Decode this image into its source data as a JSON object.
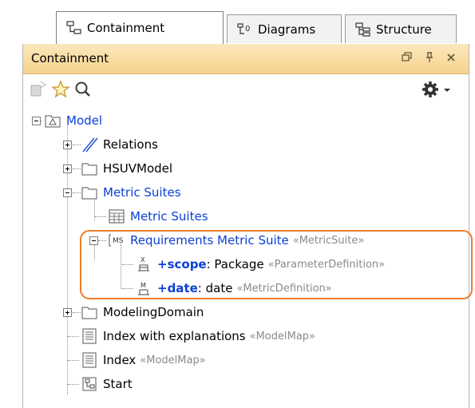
{
  "tabs": [
    {
      "label": "Containment",
      "active": true,
      "icon": "containment-icon"
    },
    {
      "label": "Diagrams",
      "active": false,
      "icon": "diagrams-icon"
    },
    {
      "label": "Structure",
      "active": false,
      "icon": "structure-icon"
    }
  ],
  "panel": {
    "title": "Containment",
    "header_icons": [
      "restore-icon",
      "pin-icon",
      "close-icon"
    ]
  },
  "toolbar": {
    "icons": [
      "new-element-icon",
      "favorite-star-icon",
      "search-icon",
      "settings-gear-icon",
      "dropdown-arrow-icon"
    ]
  },
  "tree": {
    "model": {
      "label": "Model"
    },
    "relations": {
      "label": "Relations"
    },
    "hsuv": {
      "label": "HSUVModel"
    },
    "metric_suites_pkg": {
      "label": "Metric Suites"
    },
    "metric_suites_diag": {
      "label": "Metric Suites"
    },
    "req_suite": {
      "label": "Requirements Metric Suite",
      "stereotype": "«MetricSuite»"
    },
    "scope": {
      "name": "+scope",
      "type": " : Package",
      "stereotype": "«ParameterDefinition»"
    },
    "date": {
      "name": "+date",
      "type": " : date",
      "stereotype": "«MetricDefinition»"
    },
    "modeling_domain": {
      "label": "ModelingDomain"
    },
    "index_expl": {
      "label": "Index with explanations",
      "stereotype": "«ModelMap»"
    },
    "index": {
      "label": "Index",
      "stereotype": "«ModelMap»"
    },
    "start": {
      "label": "Start"
    }
  },
  "colors": {
    "highlight": "#f07b2c",
    "link_blue": "#0b3fd6",
    "header_top": "#fbe7bd",
    "header_bottom": "#f6d38e"
  }
}
